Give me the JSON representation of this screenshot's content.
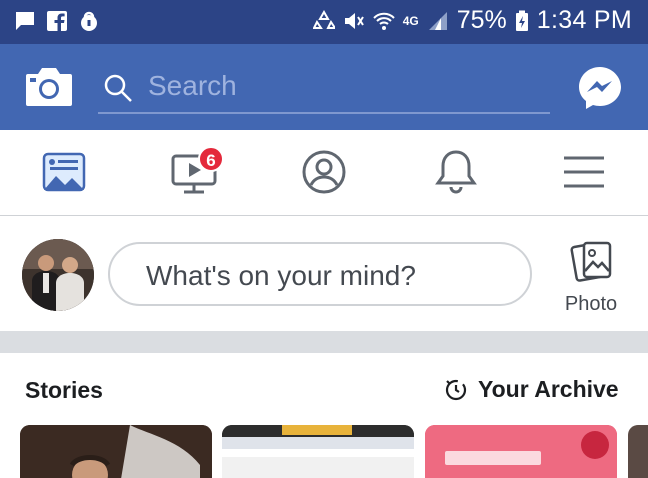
{
  "status_bar": {
    "battery": "75%",
    "time": "1:34 PM",
    "network": "4G",
    "icons": [
      "chat-icon",
      "facebook-icon",
      "lock-icon",
      "data-saver-icon",
      "mute-icon",
      "wifi-icon",
      "signal-icon",
      "battery-icon"
    ]
  },
  "header": {
    "search_placeholder": "Search",
    "icons": [
      "camera-icon",
      "search-icon",
      "messenger-icon"
    ]
  },
  "tabs": [
    {
      "name": "news-feed",
      "icon": "news-feed-icon",
      "active": true
    },
    {
      "name": "watch",
      "icon": "video-icon",
      "badge": "6"
    },
    {
      "name": "profile",
      "icon": "profile-icon"
    },
    {
      "name": "notifications",
      "icon": "bell-icon"
    },
    {
      "name": "menu",
      "icon": "hamburger-icon"
    }
  ],
  "composer": {
    "prompt": "What's on your mind?",
    "photo_label": "Photo"
  },
  "stories": {
    "title": "Stories",
    "archive_label": "Your Archive"
  },
  "colors": {
    "status_bar": "#2c4486",
    "header": "#4267b2",
    "badge": "#e4293b",
    "separator": "#dadde1"
  }
}
